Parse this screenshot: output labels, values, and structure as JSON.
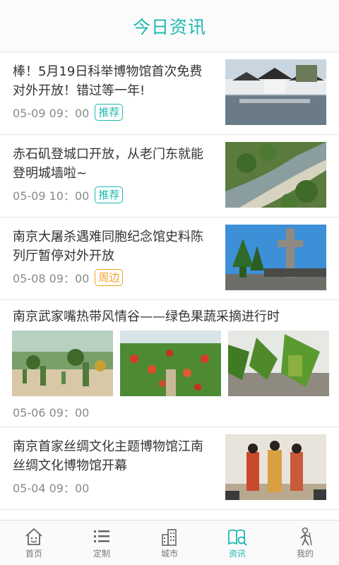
{
  "header": {
    "title": "今日资讯"
  },
  "news": [
    {
      "title": "棒！5月19日科举博物馆首次免费对外开放！错过等一年!",
      "time": "05-09  09：00",
      "tag": "推荐",
      "image": "scenic-town-photo"
    },
    {
      "title": "赤石矶登城口开放，从老门东就能登明城墙啦~",
      "time": "05-09 10：00",
      "tag": "推荐",
      "image": "aerial-greenway-photo"
    },
    {
      "title": "南京大屠杀遇难同胞纪念馆史料陈列厅暂停对外开放",
      "time": "05-08 09：00",
      "tag": "周边",
      "image": "memorial-cross-photo"
    },
    {
      "title": "南京武家嘴热带风情谷——绿色果蔬采摘进行时",
      "time": "05-06 09：00",
      "images": [
        "cactus-greenhouse-photo",
        "tomato-greenhouse-photo",
        "banana-tree-photo"
      ]
    },
    {
      "title": "南京首家丝绸文化主题博物馆江南丝绸文化博物馆开幕",
      "time": "05-04 09：00",
      "image": "silk-costume-show-photo"
    }
  ],
  "tabbar": {
    "items": [
      {
        "label": "首页",
        "icon": "home-icon"
      },
      {
        "label": "定制",
        "icon": "list-icon"
      },
      {
        "label": "城市",
        "icon": "city-icon"
      },
      {
        "label": "资讯",
        "icon": "news-icon",
        "active": true
      },
      {
        "label": "我的",
        "icon": "person-icon"
      }
    ]
  },
  "colors": {
    "accent": "#1fb9b0",
    "tag_orange": "#f0a020"
  }
}
